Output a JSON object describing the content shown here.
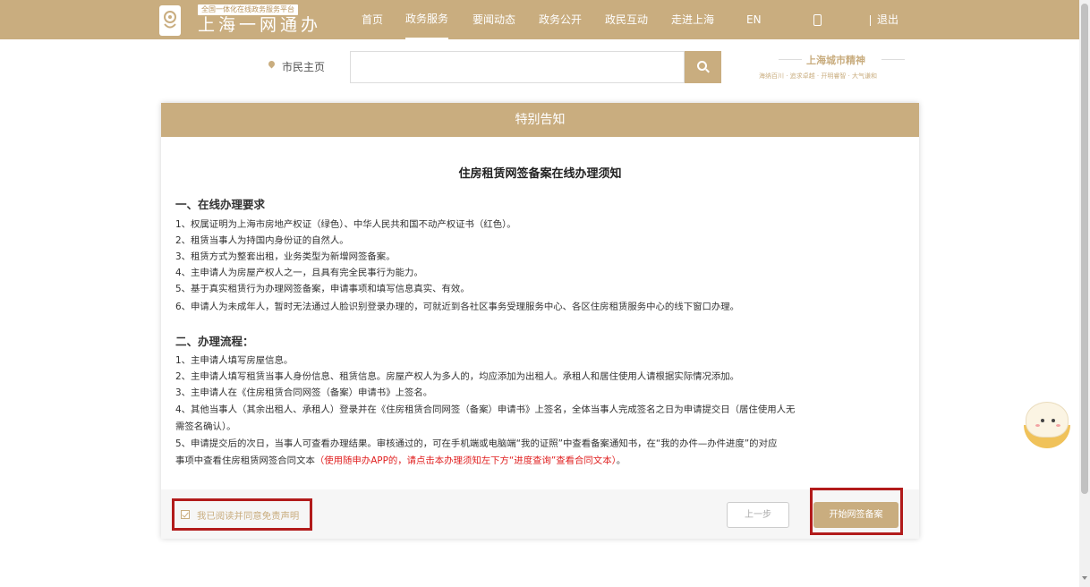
{
  "header": {
    "logo_tag": "全国一体化在线政务服务平台",
    "logo_title": "上海一网通办",
    "nav": [
      "首页",
      "政务服务",
      "要闻动态",
      "政务公开",
      "政民互动",
      "走进上海",
      "EN"
    ],
    "active_nav": "政务服务",
    "logout": "退出"
  },
  "search": {
    "location": "市民主页",
    "value": "",
    "placeholder": ""
  },
  "city_spirit": {
    "title": "上海城市精神",
    "subtitle": "海纳百川 · 追求卓越 · 开明睿智 · 大气谦和"
  },
  "notice": {
    "header": "特别告知",
    "title": "住房租赁网签备案在线办理须知",
    "section1": {
      "title": "一、在线办理要求",
      "items": [
        "1、权属证明为上海市房地产权证（绿色）、中华人民共和国不动产权证书（红色）。",
        "2、租赁当事人为持国内身份证的自然人。",
        "3、租赁方式为整套出租，业务类型为新增网签备案。",
        "4、主申请人为房屋产权人之一，且具有完全民事行为能力。",
        "5、基于真实租赁行为办理网签备案，申请事项和填写信息真实、有效。",
        "6、申请人为未成年人，暂时无法通过人脸识别登录办理的，可就近到各社区事务受理服务中心、各区住房租赁服务中心的线下窗口办理。"
      ]
    },
    "section2": {
      "title": "二、办理流程：",
      "items": [
        "1、主申请人填写房屋信息。",
        "2、主申请人填写租赁当事人身份信息、租赁信息。房屋产权人为多人的，均应添加为出租人。承租人和居住使用人请根据实际情况添加。",
        "3、主申请人在《住房租赁合同网签（备案）申请书》上签名。",
        "4、其他当事人（其余出租人、承租人）登录并在《住房租赁合同网签（备案）申请书》上签名，全体当事人完成签名之日为申请提交日（居住使用人无",
        "需签名确认）。",
        "5、申请提交后的次日，当事人可查看办理结果。审核通过的，可在手机端或电脑端“我的证照”中查看备案通知书，在“我的办件—办件进度”的对应"
      ],
      "last_line_plain": "事项中查看住房租赁网签合同文本",
      "last_line_red": "（使用随申办APP的，请点击本办理须知左下方“进度查询”查看合同文本）",
      "last_line_end": "。"
    },
    "agree_label": "我已阅读并同意免责声明",
    "agree_checked": true,
    "prev_button": "上一步",
    "start_button": "开始网签备案"
  },
  "colors": {
    "brand": "#c9ad7f",
    "highlight": "#b21b1b",
    "warning_text": "#e02020"
  }
}
